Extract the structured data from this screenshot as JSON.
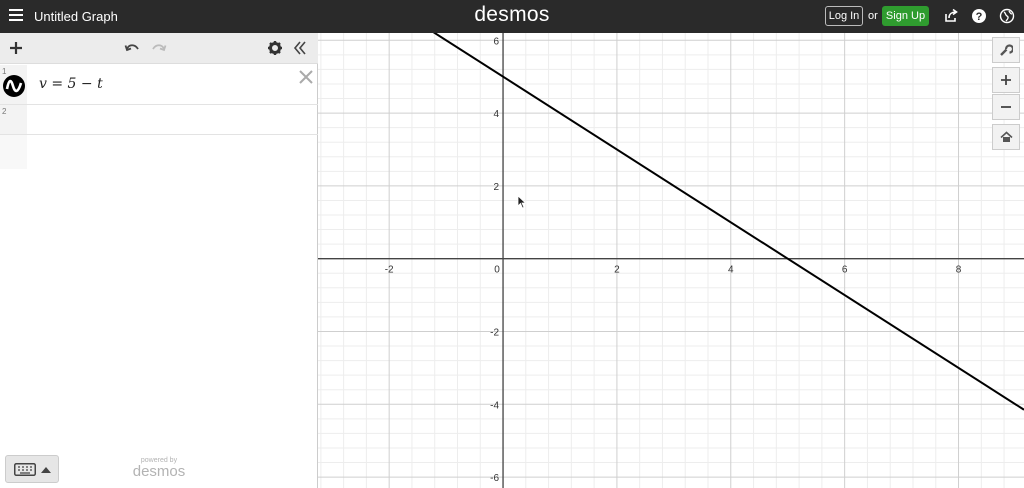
{
  "header": {
    "menu_icon": "hamburger-icon",
    "graph_title": "Untitled Graph",
    "brand": "desmos",
    "login_label": "Log In",
    "or_label": "or",
    "signup_label": "Sign Up",
    "share_icon": "share-icon",
    "help_icon": "help-icon",
    "language_icon": "globe-icon"
  },
  "expression_toolbar": {
    "add_icon": "plus-icon",
    "undo_icon": "undo-icon",
    "redo_icon": "redo-icon",
    "settings_icon": "gear-icon",
    "collapse_icon": "double-chevron-left-icon"
  },
  "expressions": [
    {
      "index": "1",
      "latex": "v = 5 − t",
      "color": "#000000"
    },
    {
      "index": "2",
      "latex": ""
    }
  ],
  "footer": {
    "keyboard_icon": "keyboard-icon",
    "powered_by": "powered by",
    "powered_brand": "desmos"
  },
  "graph": {
    "x_ticks": [
      "-2",
      "0",
      "2",
      "4",
      "6",
      "8"
    ],
    "y_ticks": [
      "6",
      "4",
      "2",
      "-2",
      "-4",
      "-6"
    ],
    "x_range": [
      -3.25,
      9.15
    ],
    "y_range": [
      -6.3,
      6.2
    ],
    "line": {
      "slope": -1,
      "intercept": 5,
      "color": "#000000"
    },
    "grid": true
  },
  "graph_controls": {
    "settings_icon": "wrench-icon",
    "zoom_in_icon": "plus-icon",
    "zoom_out_icon": "minus-icon",
    "home_icon": "home-icon"
  },
  "colors": {
    "topbar": "#2a2a2a",
    "signup": "#2f9c2f"
  }
}
